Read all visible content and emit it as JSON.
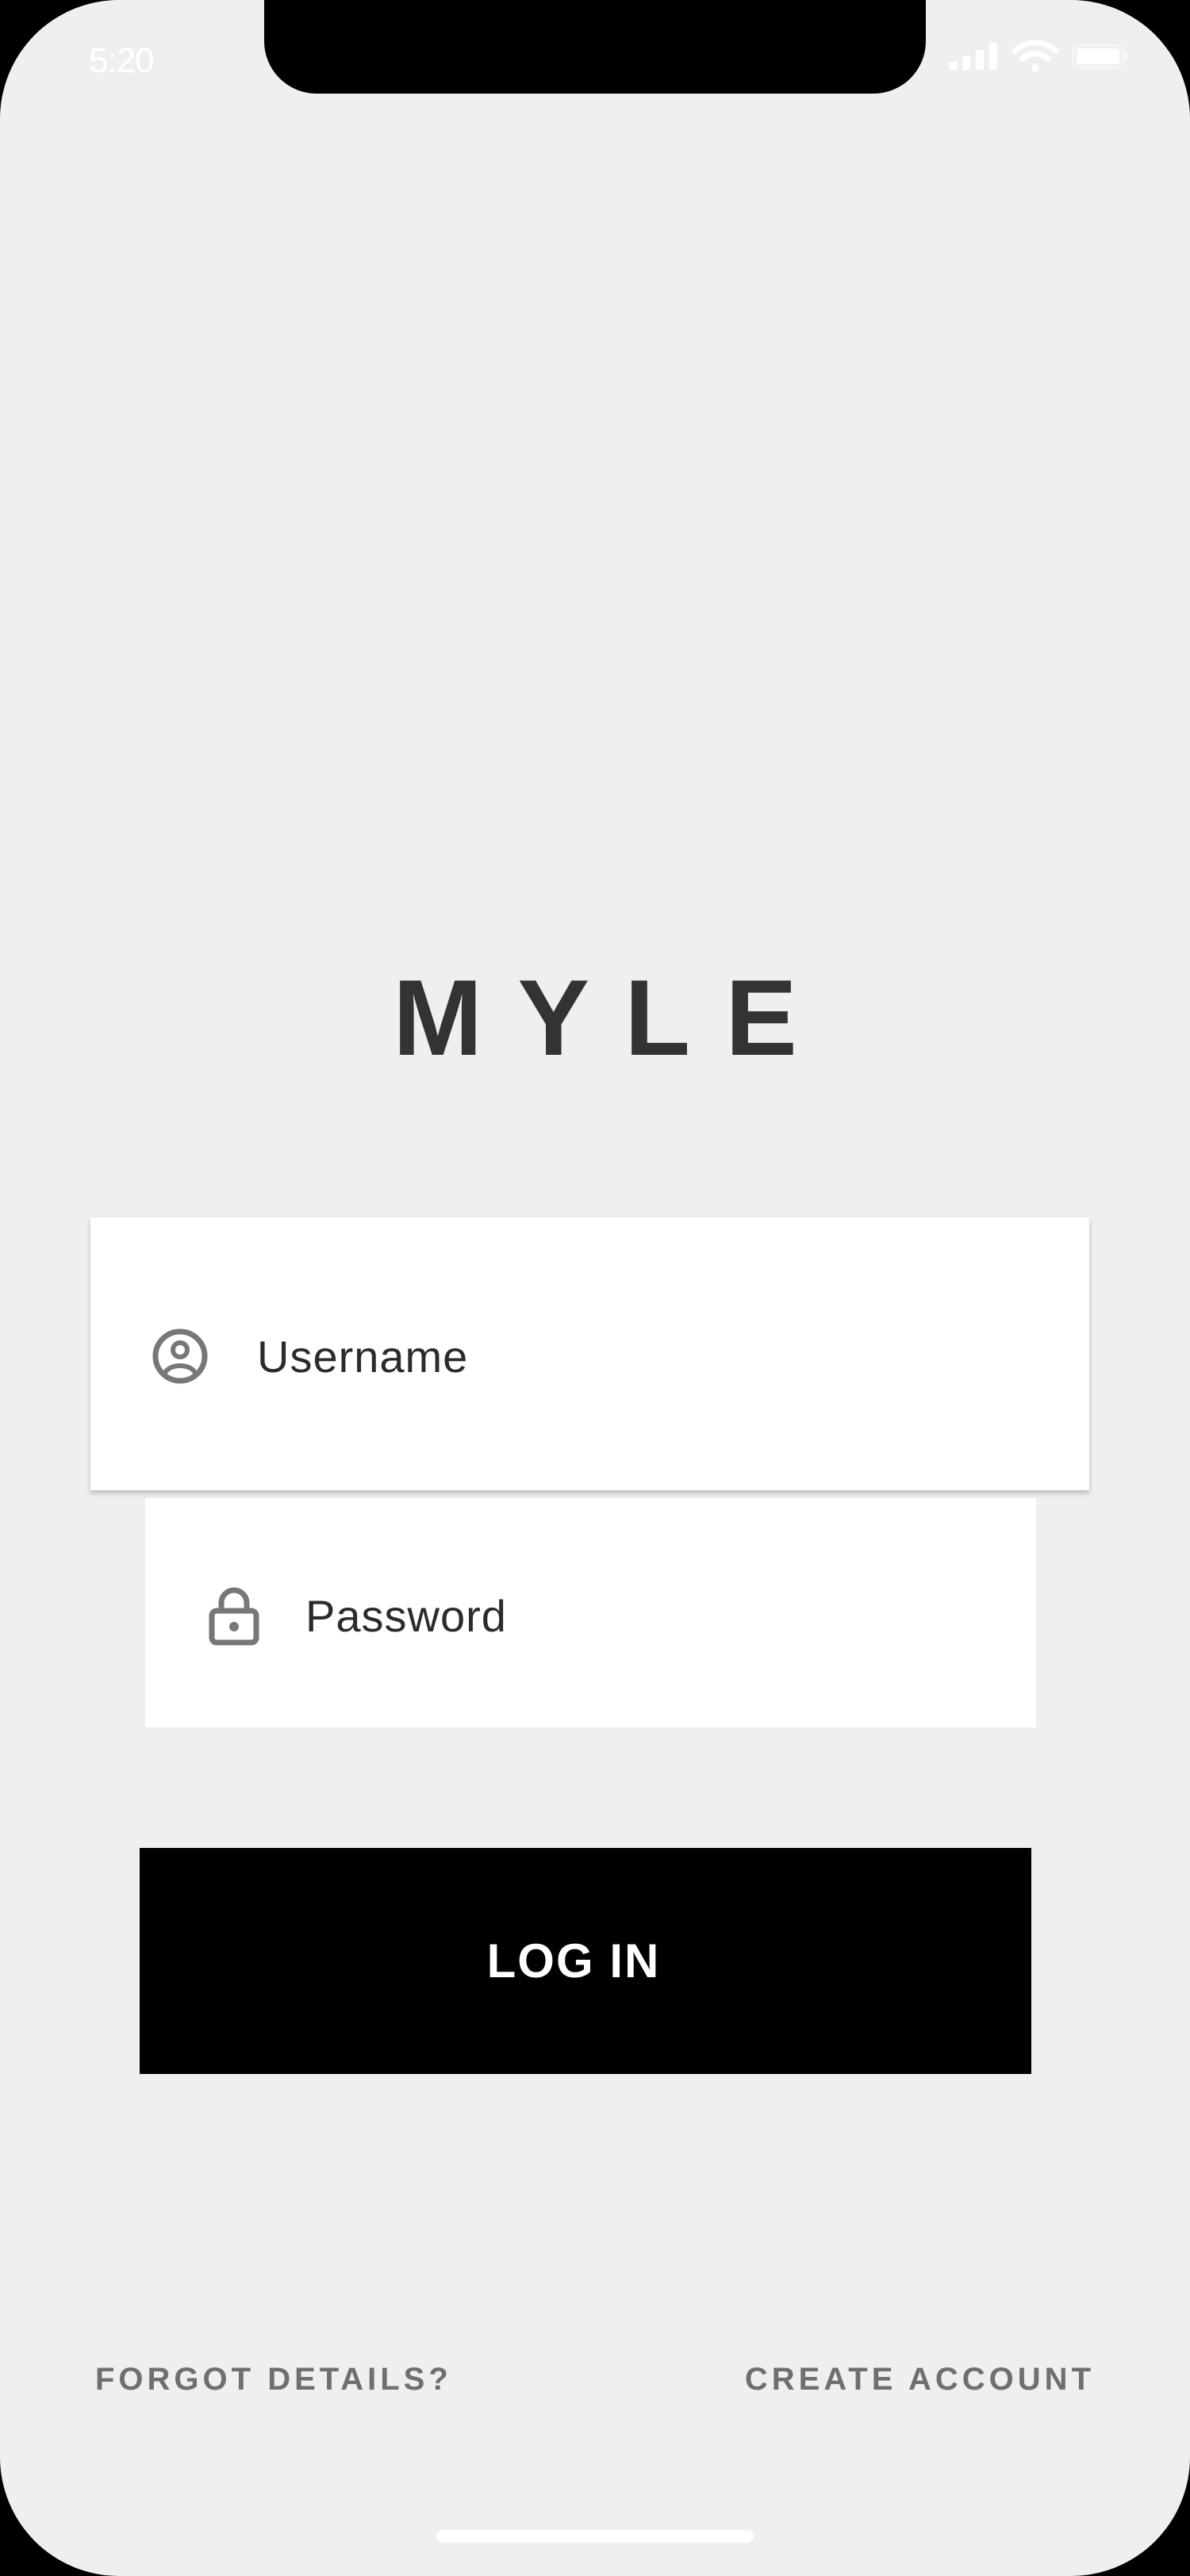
{
  "status_bar": {
    "time": "5:20",
    "icons": [
      "signal-icon",
      "wifi-icon",
      "battery-icon"
    ]
  },
  "brand": {
    "logo_text": "MYLE"
  },
  "login_form": {
    "username": {
      "placeholder": "Username",
      "value": "",
      "icon": "user-circle-icon"
    },
    "password": {
      "placeholder": "Password",
      "value": "",
      "icon": "lock-icon"
    },
    "login_label": "LOG IN"
  },
  "footer": {
    "forgot_label": "FORGOT DETAILS?",
    "create_label": "CREATE ACCOUNT"
  },
  "colors": {
    "background": "#f0eff0",
    "button": "#000000",
    "button_text": "#ffffff",
    "logo": "#333333",
    "link": "#6f6f6f",
    "icon": "#777777"
  }
}
